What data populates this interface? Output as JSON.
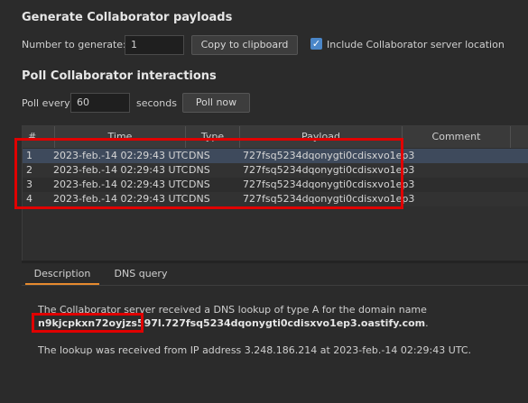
{
  "generate": {
    "title": "Generate Collaborator payloads",
    "number_label": "Number to generate:",
    "number_value": "1",
    "copy_button": "Copy to clipboard",
    "include_label": "Include Collaborator server location",
    "include_checked": true
  },
  "poll": {
    "title": "Poll Collaborator interactions",
    "poll_every_label": "Poll every",
    "poll_every_value": "60",
    "seconds_label": "seconds",
    "poll_now_button": "Poll now"
  },
  "table": {
    "columns": [
      "#",
      "Time",
      "Type",
      "Payload",
      "Comment"
    ],
    "rows": [
      {
        "num": "1",
        "time": "2023-feb.-14 02:29:43 UTC",
        "type": "DNS",
        "payload": "727fsq5234dqonygti0cdisxvo1ep3",
        "comment": ""
      },
      {
        "num": "2",
        "time": "2023-feb.-14 02:29:43 UTC",
        "type": "DNS",
        "payload": "727fsq5234dqonygti0cdisxvo1ep3",
        "comment": ""
      },
      {
        "num": "3",
        "time": "2023-feb.-14 02:29:43 UTC",
        "type": "DNS",
        "payload": "727fsq5234dqonygti0cdisxvo1ep3",
        "comment": ""
      },
      {
        "num": "4",
        "time": "2023-feb.-14 02:29:43 UTC",
        "type": "DNS",
        "payload": "727fsq5234dqonygti0cdisxvo1ep3",
        "comment": ""
      }
    ]
  },
  "detail": {
    "tabs": [
      "Description",
      "DNS query"
    ],
    "line1": "The Collaborator server received a DNS lookup of type A for the domain name",
    "domain_prefix": "n9kjcpkxn72oyjzs597l",
    "domain_rest": ".727fsq5234dqonygti0cdisxvo1ep3.oastify.com",
    "domain_end": ".",
    "line3": "The lookup was received from IP address 3.248.186.214 at 2023-feb.-14 02:29:43 UTC."
  },
  "colors": {
    "selected_row": "#3e4a5c",
    "highlight_box": "#e00000",
    "accent_tab": "#e68a2e",
    "checkbox": "#4a86c8"
  }
}
